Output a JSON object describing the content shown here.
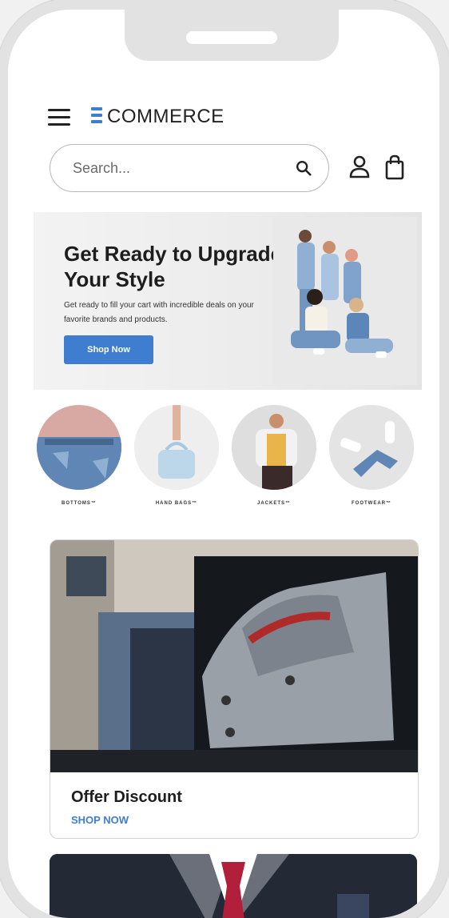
{
  "app": {
    "logo_text": "COMMERCE",
    "accent_color": "#3e7dd0"
  },
  "header": {
    "menu_icon": "hamburger-menu-icon",
    "search": {
      "placeholder": "Search...",
      "value": ""
    },
    "icons": [
      "search-icon",
      "user-icon",
      "shopping-bag-icon"
    ]
  },
  "hero": {
    "title": "Get Ready to Upgrade Your Style",
    "subtitle": "Get ready to fill your cart with incredible deals on your favorite brands and products.",
    "cta_label": "Shop Now"
  },
  "categories": [
    {
      "label": "BOTTOMS™"
    },
    {
      "label": "HAND BAGS™"
    },
    {
      "label": "JACKETS™"
    },
    {
      "label": "FOOTWEAR™"
    }
  ],
  "offer_card": {
    "title": "Offer Discount",
    "link_label": "SHOP NOW"
  }
}
